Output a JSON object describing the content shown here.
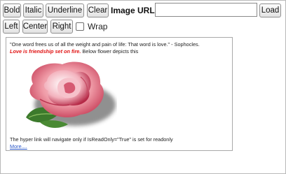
{
  "toolbar": {
    "bold_label": "Bold",
    "italic_label": "Italic",
    "underline_label": "Underline",
    "clear_label": "Clear",
    "image_url_label": "Image URL",
    "image_url_value": "",
    "load_label": "Load",
    "left_label": "Left",
    "center_label": "Center",
    "right_label": "Right",
    "wrap_label": "Wrap",
    "wrap_checked": false
  },
  "editor": {
    "quote": "\"One word frees us of all the weight and pain of life: That word is love.\" - Sophocles.",
    "love_text": "Love is friendship set on fire.",
    "flower_text": " Below flower depicts this",
    "hyperlink_note": "The hyper link will navigate only if IsReadOnly=\"True\" is set for readonly",
    "more_link": "More....",
    "image_icon": "rose-image"
  }
}
